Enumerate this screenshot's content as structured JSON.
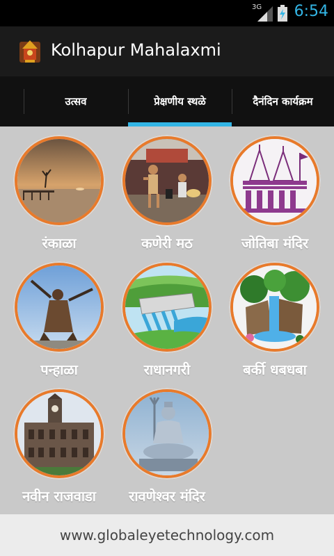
{
  "status": {
    "network": "3G",
    "time": "6:54",
    "colors": {
      "time": "#33b5e5"
    }
  },
  "app": {
    "title": "Kolhapur Mahalaxmi",
    "icon": "temple-icon"
  },
  "tabs": [
    {
      "label": "उत्सव",
      "selected": false
    },
    {
      "label": "प्रेक्षणीय स्थळे",
      "selected": true
    },
    {
      "label": "दैनंदिन कार्यक्रम",
      "selected": false
    }
  ],
  "places": [
    {
      "label": "रंकाळा",
      "image": "lake-sunset-image"
    },
    {
      "label": "कणेरी मठ",
      "image": "math-statues-image"
    },
    {
      "label": "जोतिबा मंदिर",
      "image": "jotiba-temple-image"
    },
    {
      "label": "पन्हाळा",
      "image": "warrior-statue-image"
    },
    {
      "label": "राधानगरी",
      "image": "dam-image"
    },
    {
      "label": "बर्की धबधबा",
      "image": "waterfall-image"
    },
    {
      "label": "नवीन राजवाडा",
      "image": "palace-image"
    },
    {
      "label": "रावणेश्वर मंदिर",
      "image": "shiva-statue-image"
    }
  ],
  "footer": {
    "text": "www.globaleyetechnology.com"
  },
  "colors": {
    "accent": "#33b5e5",
    "ring": "#e87a2b",
    "background": "#c9c9c9"
  }
}
